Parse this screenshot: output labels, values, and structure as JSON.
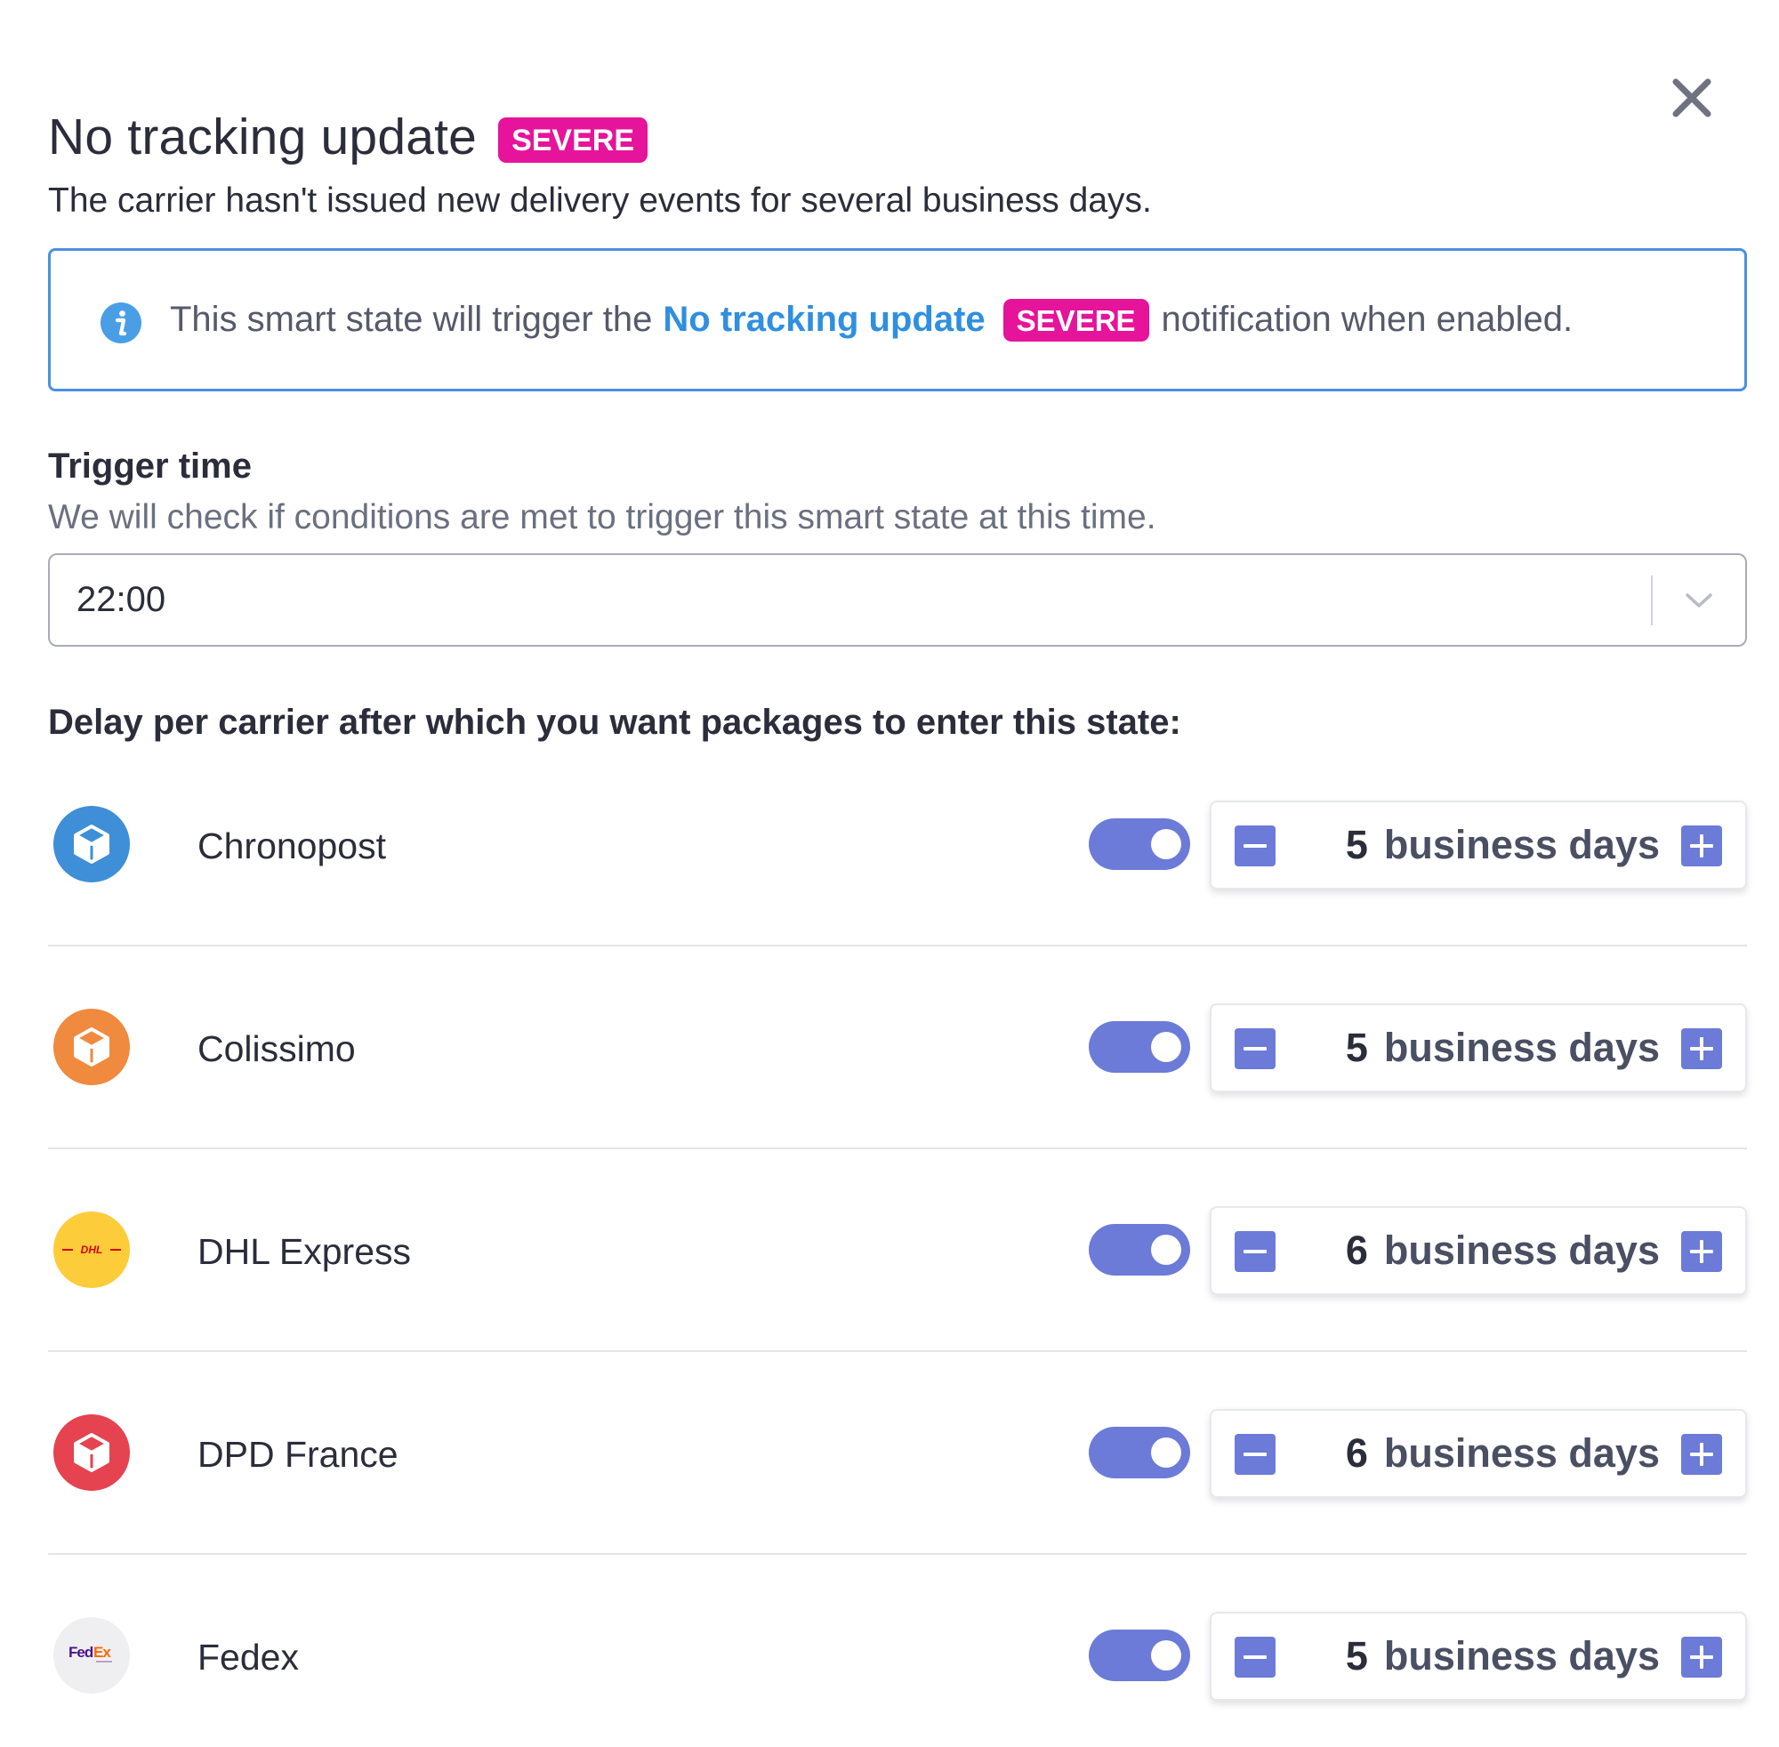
{
  "header": {
    "title": "No tracking update",
    "badge": "SEVERE",
    "subtitle": "The carrier hasn't issued new delivery events for several business days."
  },
  "info_banner": {
    "prefix": "This smart state will trigger the",
    "link": "No tracking update",
    "badge": "SEVERE",
    "suffix": "notification when enabled."
  },
  "trigger_time": {
    "label": "Trigger time",
    "help": "We will check if conditions are met to trigger this smart state at this time.",
    "value": "22:00"
  },
  "delay": {
    "label": "Delay per carrier after which you want packages to enter this state:",
    "unit": "business days",
    "carriers": [
      {
        "name": "Chronopost",
        "days": "5",
        "enabled": true,
        "logo_color": "#3e8fd8",
        "logo_icon": "box-icon"
      },
      {
        "name": "Colissimo",
        "days": "5",
        "enabled": true,
        "logo_color": "#ef8a3e",
        "logo_icon": "box-icon"
      },
      {
        "name": "DHL Express",
        "days": "6",
        "enabled": true,
        "logo_color": "#fccc3a",
        "logo_text": "DHL"
      },
      {
        "name": "DPD France",
        "days": "6",
        "enabled": true,
        "logo_color": "#e4434f",
        "logo_icon": "box-icon"
      },
      {
        "name": "Fedex",
        "days": "5",
        "enabled": true,
        "logo_color": "#efeff1",
        "logo_text": "FedEx"
      }
    ]
  },
  "colors": {
    "accent": "#6c7bd8",
    "severe": "#e5149a",
    "link": "#2f8fe0",
    "info_border": "#4a90e2"
  }
}
